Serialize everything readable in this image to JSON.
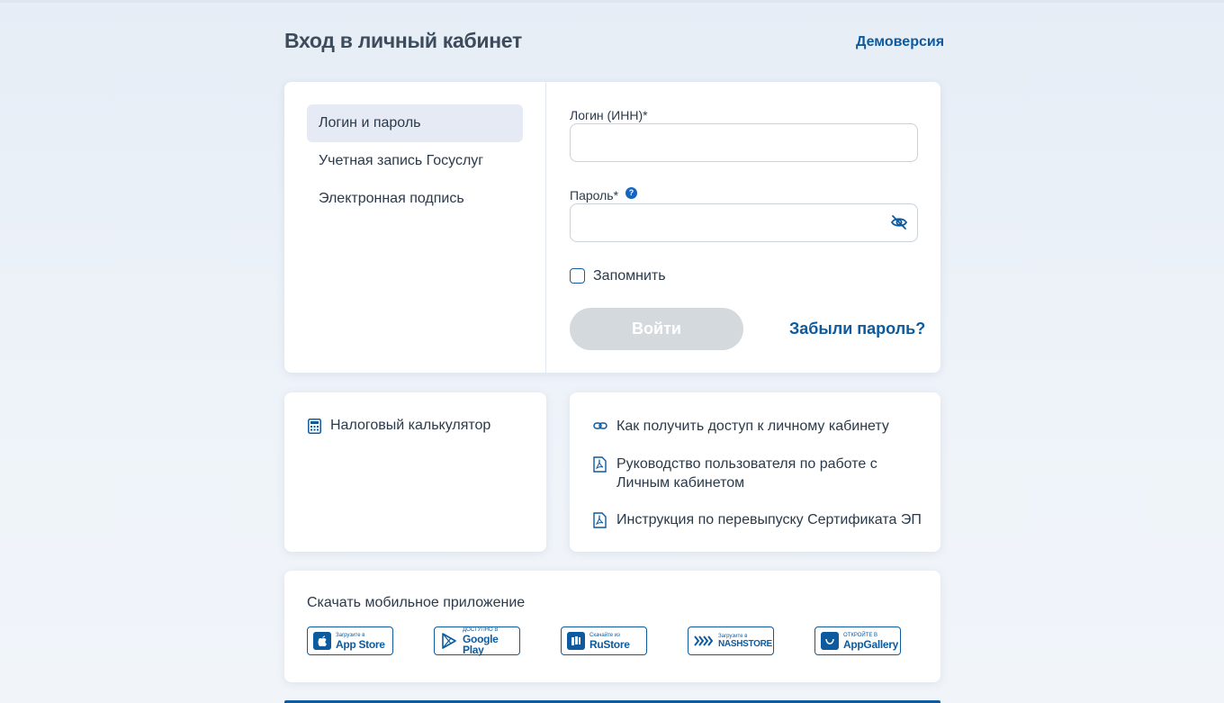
{
  "page": {
    "title": "Вход в личный кабинет",
    "demo_link": "Демоверсия"
  },
  "login": {
    "methods": [
      {
        "label": "Логин и пароль",
        "active": true
      },
      {
        "label": "Учетная запись Госуслуг",
        "active": false
      },
      {
        "label": "Электронная подпись",
        "active": false
      }
    ],
    "login_label": "Логин (ИНН)*",
    "login_value": "",
    "password_label": "Пароль*",
    "password_value": "",
    "help_glyph": "?",
    "remember_label": "Запомнить",
    "remember_checked": false,
    "submit_label": "Войти",
    "forgot_label": "Забыли пароль?"
  },
  "calculator": {
    "label": "Налоговый калькулятор",
    "icon": "calculator-icon"
  },
  "links": [
    {
      "icon": "link-icon",
      "lines": [
        "Как получить доступ к личному кабинету"
      ]
    },
    {
      "icon": "pdf-icon",
      "lines": [
        "Руководство пользователя по работе с",
        "Личным кабинетом"
      ]
    },
    {
      "icon": "pdf-icon",
      "lines": [
        "Инструкция по перевыпуску Сертификата ЭП"
      ]
    }
  ],
  "apps": {
    "title": "Скачать мобильное приложение",
    "stores": [
      {
        "small": "Загрузите в",
        "big": "App Store",
        "icon": "apple-icon"
      },
      {
        "small": "ДОСТУПНО В",
        "big": "Google Play",
        "icon": "google-play-icon"
      },
      {
        "small": "Скачайте из",
        "big": "RuStore",
        "icon": "rustore-icon"
      },
      {
        "small": "Загрузите в",
        "big": "NASHSTORE",
        "icon": "nashstore-icon"
      },
      {
        "small": "ОТКРОЙТЕ В",
        "big": "AppGallery",
        "icon": "appgallery-icon"
      }
    ]
  },
  "colors": {
    "accent": "#0d5a9e",
    "button_disabled": "#d4d9de",
    "active_tab": "#e6eaf4"
  }
}
